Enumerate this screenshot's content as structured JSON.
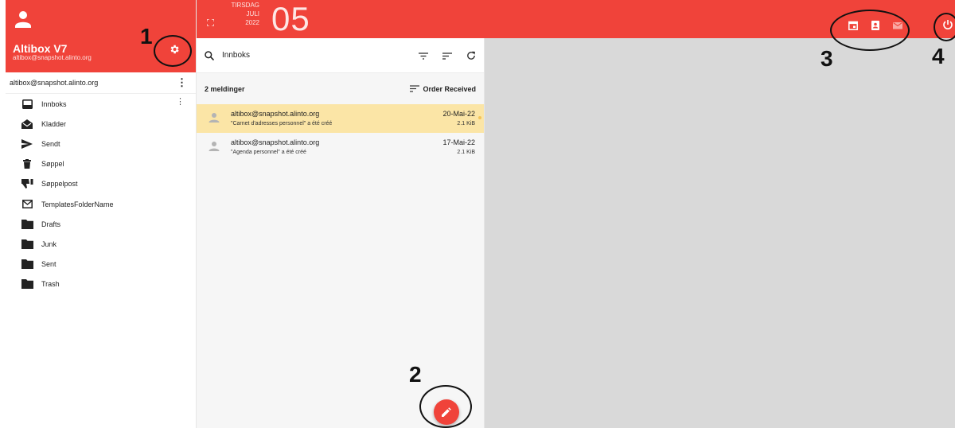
{
  "account": {
    "name": "Altibox V7",
    "email": "altibox@snapshot.alinto.org"
  },
  "sidebar": {
    "account_row": "altibox@snapshot.alinto.org",
    "folders": [
      {
        "label": "Innboks",
        "icon": "inbox-icon"
      },
      {
        "label": "Kladder",
        "icon": "drafts-icon"
      },
      {
        "label": "Sendt",
        "icon": "send-icon"
      },
      {
        "label": "Søppel",
        "icon": "trash-icon"
      },
      {
        "label": "Søppelpost",
        "icon": "thumbs-down-icon"
      },
      {
        "label": "TemplatesFolderName",
        "icon": "mail-outline-icon"
      },
      {
        "label": "Drafts",
        "icon": "folder-icon"
      },
      {
        "label": "Junk",
        "icon": "folder-icon"
      },
      {
        "label": "Sent",
        "icon": "folder-icon"
      },
      {
        "label": "Trash",
        "icon": "folder-icon"
      }
    ]
  },
  "topbar": {
    "weekday": "TIRSDAG",
    "month": "JULI",
    "year": "2022",
    "day": "05",
    "icons": [
      "calendar-icon",
      "contacts-icon",
      "mail-icon",
      "power-icon"
    ]
  },
  "messages": {
    "search_value": "Innboks",
    "count_label": "2 meldinger",
    "sort_label": "Order Received",
    "items": [
      {
        "from": "altibox@snapshot.alinto.org",
        "subject": "\"Carnet d'adresses personnel\" a été créé",
        "date": "20-Mai-22",
        "size": "2.1 KiB"
      },
      {
        "from": "altibox@snapshot.alinto.org",
        "subject": "\"Agenda personnel\" a été créé",
        "date": "17-Mai-22",
        "size": "2.1 KiB"
      }
    ]
  },
  "annotations": [
    "1",
    "2",
    "3",
    "4"
  ],
  "colors": {
    "accent": "#f0433a",
    "selected_row": "#fbe5a6",
    "reading_pane": "#d9d9d9"
  }
}
